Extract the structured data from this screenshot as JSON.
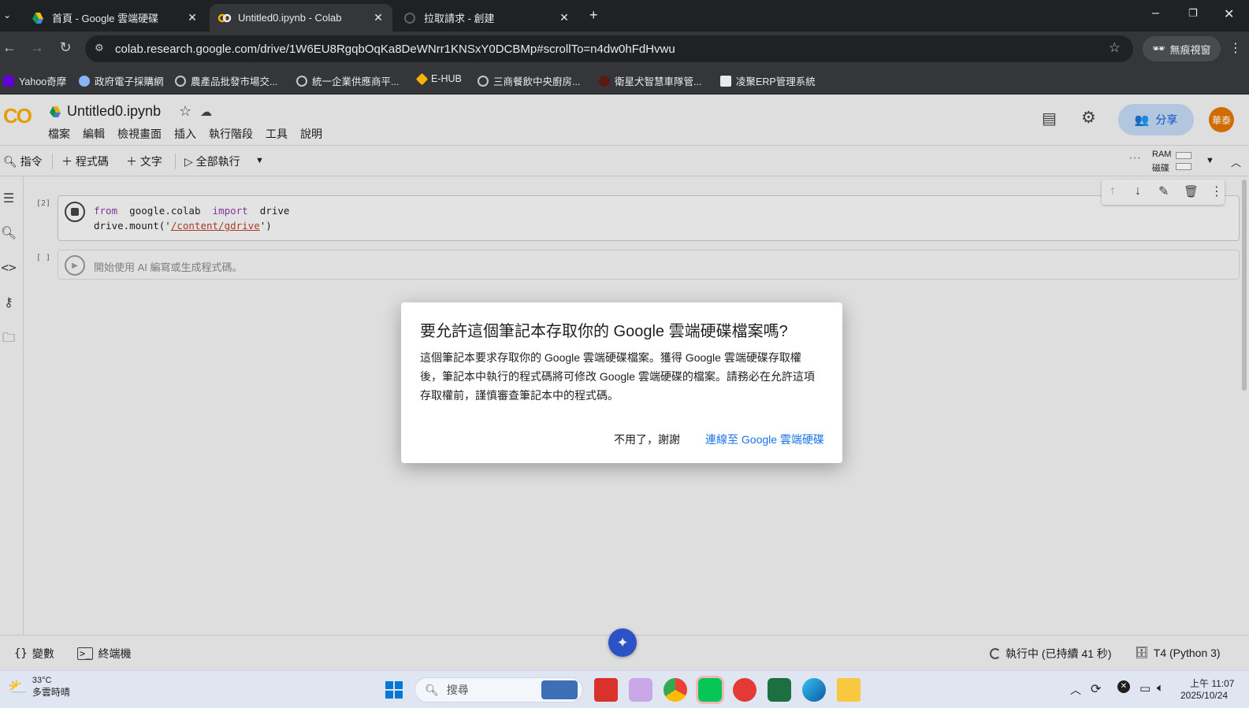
{
  "browser": {
    "tabs": [
      {
        "title": "首頁 - Google 雲端硬碟",
        "active": false
      },
      {
        "title": "Untitled0.ipynb - Colab",
        "active": true
      },
      {
        "title": "拉取請求 - 創建",
        "active": false
      }
    ],
    "url": "colab.research.google.com/drive/1W6EU8RgqbOqKa8DeWNrr1KNSxY0DCBMp#scrollTo=n4dw0hFdHvwu",
    "incognito_label": "無痕視窗",
    "bookmarks": [
      "Yahoo奇摩",
      "政府電子採購網",
      "農產品批發市場交...",
      "統一企業供應商平...",
      "E-HUB",
      "三商餐飲中央廚房...",
      "衛星犬智慧車隊管...",
      "凌聚ERP管理系統"
    ]
  },
  "colab": {
    "logo": "CO",
    "notebook_title": "Untitled0.ipynb",
    "menu": [
      "檔案",
      "編輯",
      "檢視畫面",
      "插入",
      "執行階段",
      "工具",
      "說明"
    ],
    "share_label": "分享",
    "avatar_text": "華泰",
    "toolbar": {
      "commands": "指令",
      "add_code": "程式碼",
      "add_text": "文字",
      "run_all": "全部執行",
      "ram": "RAM",
      "disk": "磁碟"
    },
    "cells": [
      {
        "exec_count": "[2]",
        "line1_kw1": "from",
        "line1_mod": "google.colab",
        "line1_kw2": "import",
        "line1_name": "drive",
        "line2_prefix": "drive.mount('",
        "line2_str": "/content/gdrive",
        "line2_suffix": "')"
      },
      {
        "exec_count": "[ ]",
        "placeholder": "開始使用 AI 編寫或生成程式碼。"
      }
    ],
    "bottom": {
      "variables": "變數",
      "terminal": "終端機",
      "status": "執行中 (已持續 41 秒)",
      "runtime": "T4 (Python 3)"
    }
  },
  "dialog": {
    "title": "要允許這個筆記本存取你的 Google 雲端硬碟檔案嗎?",
    "body": "這個筆記本要求存取你的 Google 雲端硬碟檔案。獲得 Google 雲端硬碟存取權後，筆記本中執行的程式碼將可修改 Google 雲端硬碟的檔案。請務必在允許這項存取權前，謹慎審查筆記本中的程式碼。",
    "decline": "不用了，謝謝",
    "connect": "連線至 Google 雲端硬碟"
  },
  "taskbar": {
    "weather_temp": "33°C",
    "weather_desc": "多雲時晴",
    "search_placeholder": "搜尋",
    "time": "上午 11:07",
    "date": "2025/10/24"
  },
  "colors": {
    "accent": "#1a73e8",
    "share_bg": "#c2d8f2",
    "avatar_bg": "#e37400",
    "keyword": "#8a3aa8",
    "string": "#b5402c"
  }
}
